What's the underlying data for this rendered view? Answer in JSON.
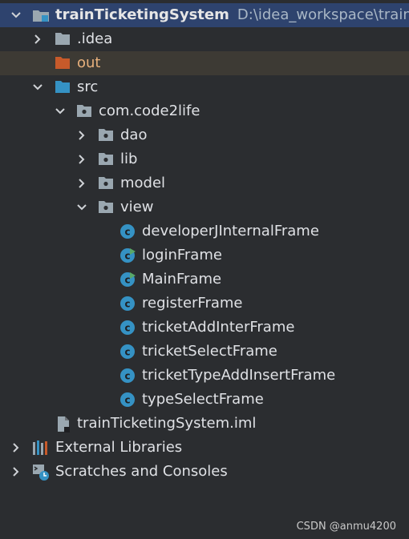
{
  "project": {
    "name": "trainTicketingSystem",
    "path": "D:\\idea_workspace\\trainTick"
  },
  "tree": {
    "idea": ".idea",
    "out": "out",
    "src": "src",
    "package": "com.code2life",
    "dao": "dao",
    "lib": "lib",
    "model": "model",
    "view": "view",
    "classes": [
      "developerJInternalFrame",
      "loginFrame",
      "MainFrame",
      "registerFrame",
      "tricketAddInterFrame",
      "tricketSelectFrame",
      "tricketTypeAddInsertFrame",
      "typeSelectFrame"
    ],
    "iml": "trainTicketingSystem.iml",
    "external_libraries": "External Libraries",
    "scratches": "Scratches and Consoles"
  },
  "watermark": "CSDN @anmu4200",
  "colors": {
    "background": "#2b2d30",
    "selection": "#2e436e",
    "folder": "#9aa7b0",
    "source_folder": "#3592c4",
    "excluded_folder": "#c75a2a",
    "class_icon": "#3592c4",
    "run_marker": "#59a869"
  }
}
